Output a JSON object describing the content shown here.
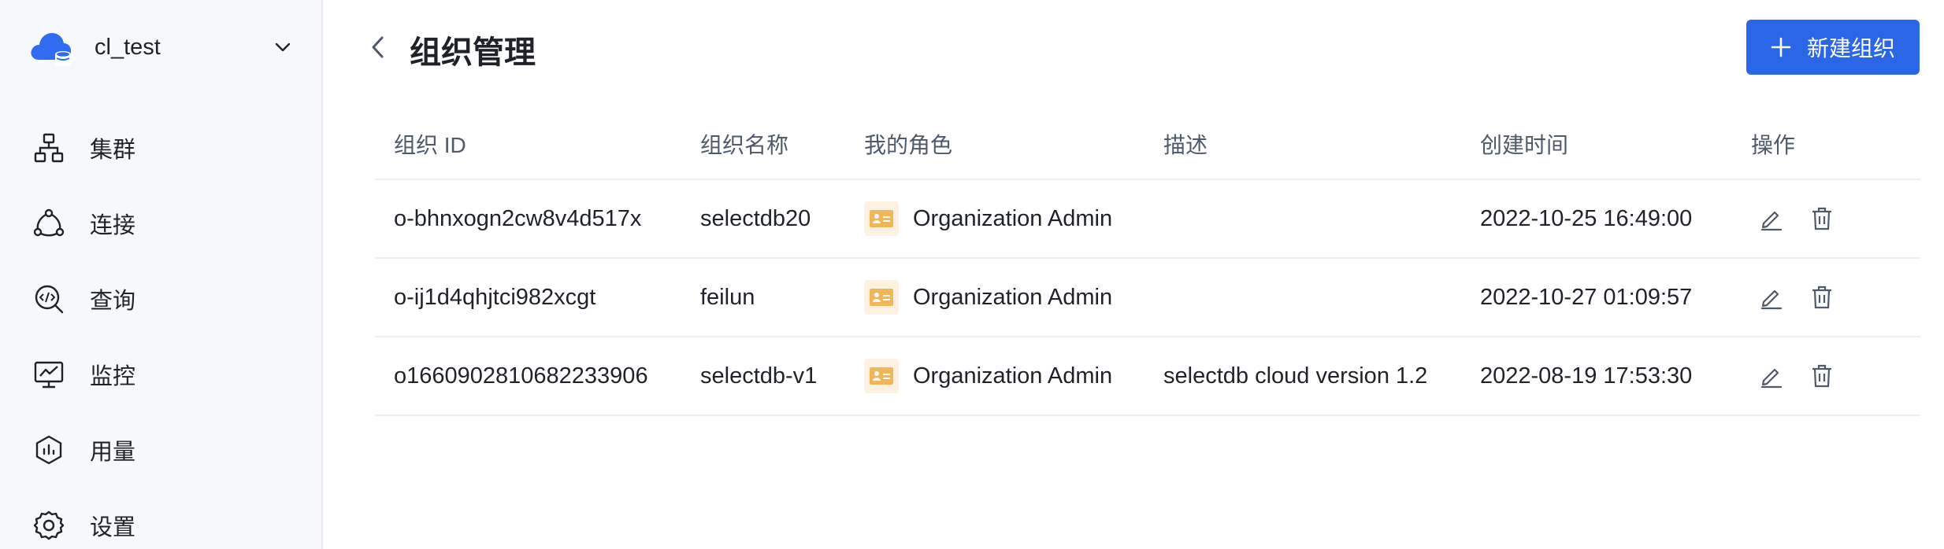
{
  "sidebar": {
    "org_name": "cl_test",
    "items": [
      {
        "label": "集群",
        "icon": "cluster-icon"
      },
      {
        "label": "连接",
        "icon": "connection-icon"
      },
      {
        "label": "查询",
        "icon": "query-icon"
      },
      {
        "label": "监控",
        "icon": "monitor-icon"
      },
      {
        "label": "用量",
        "icon": "usage-icon"
      },
      {
        "label": "设置",
        "icon": "settings-icon"
      }
    ]
  },
  "header": {
    "title": "组织管理",
    "new_button": "新建组织"
  },
  "table": {
    "columns": [
      "组织 ID",
      "组织名称",
      "我的角色",
      "描述",
      "创建时间",
      "操作"
    ],
    "rows": [
      {
        "id": "o-bhnxogn2cw8v4d517x",
        "name": "selectdb20",
        "role": "Organization Admin",
        "desc": "",
        "created": "2022-10-25 16:49:00"
      },
      {
        "id": "o-ij1d4qhjtci982xcgt",
        "name": "feilun",
        "role": "Organization Admin",
        "desc": "",
        "created": "2022-10-27 01:09:57"
      },
      {
        "id": "o1660902810682233906",
        "name": "selectdb-v1",
        "role": "Organization Admin",
        "desc": "selectdb cloud version 1.2",
        "created": "2022-08-19 17:53:30"
      }
    ]
  },
  "colors": {
    "accent": "#2b66e6",
    "brand_icon": "#2f6cf0",
    "role_badge_bg": "#fdf2e2",
    "role_badge_fg": "#f0b65a"
  }
}
